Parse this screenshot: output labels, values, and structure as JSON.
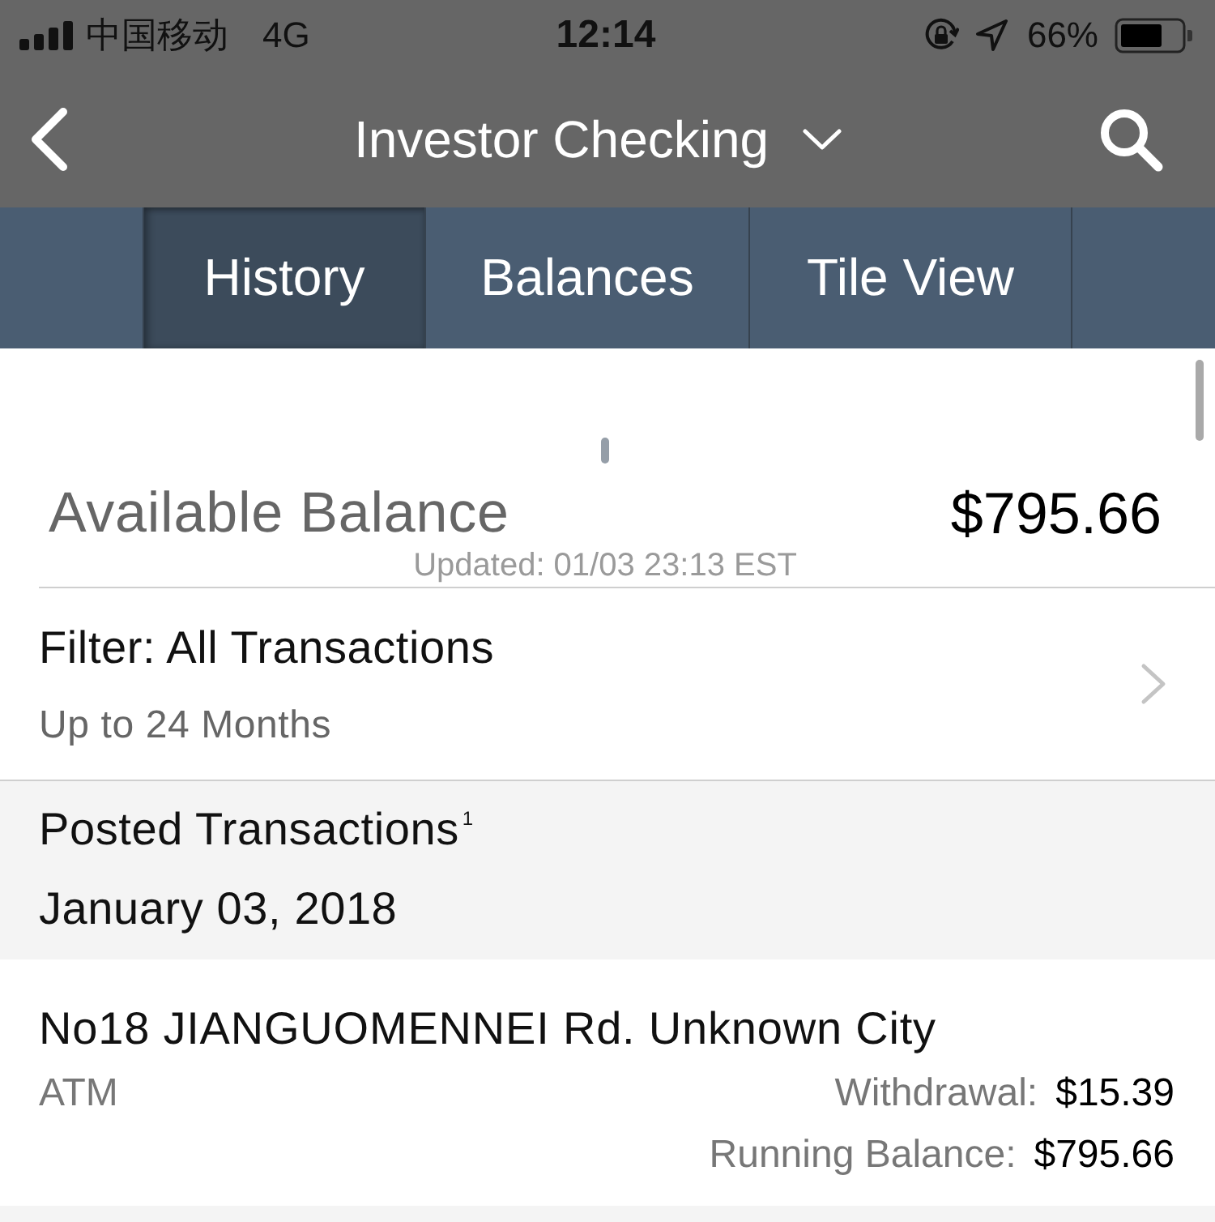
{
  "status_bar": {
    "carrier": "中国移动",
    "network": "4G",
    "time": "12:14",
    "battery_percent": "66%"
  },
  "nav_bar": {
    "title": "Investor Checking"
  },
  "tabs": [
    {
      "label": "History",
      "selected": true
    },
    {
      "label": "Balances",
      "selected": false
    },
    {
      "label": "Tile View",
      "selected": false
    }
  ],
  "balance": {
    "label": "Available Balance",
    "amount": "$795.66",
    "updated": "Updated: 01/03 23:13 EST"
  },
  "filter": {
    "title": "Filter: All Transactions",
    "subtitle": "Up to 24 Months"
  },
  "section": {
    "title": "Posted Transactions$^{1}$",
    "date": "January 03, 2018"
  },
  "transactions": [
    {
      "description": "No18 JIANGUOMENNEI Rd. Unknown City",
      "type": "ATM",
      "amount_label": "Withdrawal:",
      "amount": "$15.39",
      "running_label": "Running Balance:",
      "running_balance": "$795.66"
    }
  ]
}
